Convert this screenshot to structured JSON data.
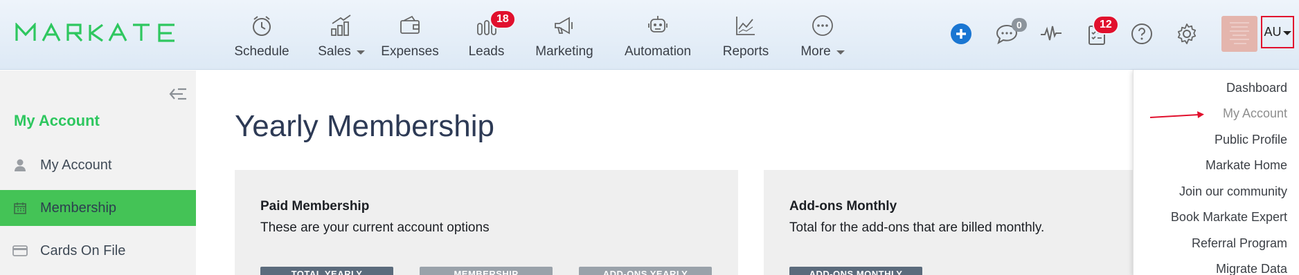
{
  "brand": {
    "logo_text": "MARKATE",
    "accent": "#2ec75f"
  },
  "nav": {
    "items": [
      {
        "label": "Schedule",
        "icon": "clock-icon"
      },
      {
        "label": "Sales",
        "icon": "bar-chart-coins-icon",
        "has_caret": true
      },
      {
        "label": "Expenses",
        "icon": "wallet-icon"
      },
      {
        "label": "Leads",
        "icon": "bottles-icon",
        "badge": "18"
      },
      {
        "label": "Marketing",
        "icon": "megaphone-icon"
      },
      {
        "label": "Automation",
        "icon": "robot-icon"
      },
      {
        "label": "Reports",
        "icon": "line-chart-icon"
      },
      {
        "label": "More",
        "icon": "ellipsis-circle-icon",
        "has_caret": true
      }
    ],
    "messages_badge": "0",
    "tasks_badge": "12",
    "user_initials": "AU",
    "badge_color": "#e1102d"
  },
  "sidebar": {
    "title": "My Account",
    "items": [
      {
        "label": "My Account",
        "icon": "user-icon"
      },
      {
        "label": "Membership",
        "icon": "calendar-icon",
        "active": true
      },
      {
        "label": "Cards On File",
        "icon": "credit-card-icon"
      }
    ],
    "active_color": "#44c356"
  },
  "main": {
    "title": "Yearly Membership",
    "cards": [
      {
        "title": "Paid Membership",
        "subtitle": "These are your current account options",
        "tabs": [
          "TOTAL YEARLY",
          "MEMBERSHIP",
          "ADD-ONS YEARLY"
        ]
      },
      {
        "title": "Add-ons Monthly",
        "subtitle": "Total for the add-ons that are billed monthly.",
        "tabs": [
          "ADD-ONS MONTHLY"
        ]
      }
    ]
  },
  "user_menu": {
    "items": [
      "Dashboard",
      "My Account",
      "Public Profile",
      "Markate Home",
      "Join our community",
      "Book Markate Expert",
      "Referral Program",
      "Migrate Data"
    ]
  }
}
